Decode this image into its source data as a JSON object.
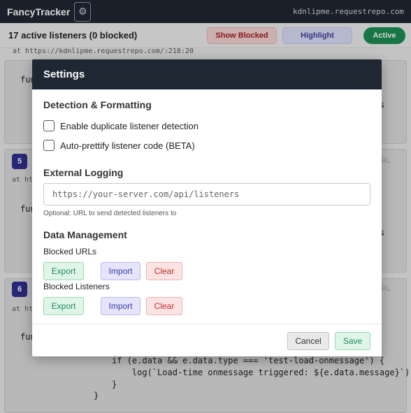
{
  "app": {
    "brand": "FancyTracker",
    "settings_icon": "gear-icon",
    "domain": "kdnlipme.requestrepo.com"
  },
  "status": {
    "count_text": "17 active listeners (0 blocked)",
    "show_blocked_label": "Show Blocked",
    "highlight_label": "Highlight",
    "active_label": "Active"
  },
  "listeners": [
    {
      "location": "at https://kdnlipme.requestrepo.com/:218:20",
      "code_start": "fun",
      "trailing": "s"
    },
    {
      "number": "5",
      "location_start": "at htt",
      "code_start": "fun",
      "trailing": "s",
      "right_text": "URL"
    },
    {
      "number": "6",
      "location_start": "at htt",
      "code_start": "fun",
      "right_text": "URL"
    }
  ],
  "code_lines": [
    "if (e.data && e.data.type === 'test-load-onmessage') {",
    "    log(`Load-time onmessage triggered: ${e.data.message}`);",
    "}",
    "}"
  ],
  "modal": {
    "title": "Settings",
    "detection": {
      "title": "Detection & Formatting",
      "duplicate_label": "Enable duplicate listener detection",
      "prettify_label": "Auto-prettify listener code (BETA)"
    },
    "logging": {
      "title": "External Logging",
      "url_placeholder": "https://your-server.com/api/listeners",
      "url_value": "",
      "hint": "Optional: URL to send detected listeners to"
    },
    "data": {
      "title": "Data Management",
      "blocked_urls_label": "Blocked URLs",
      "blocked_listeners_label": "Blocked Listeners",
      "export_label": "Export",
      "import_label": "Import",
      "clear_label": "Clear"
    },
    "footer": {
      "cancel_label": "Cancel",
      "save_label": "Save"
    }
  }
}
